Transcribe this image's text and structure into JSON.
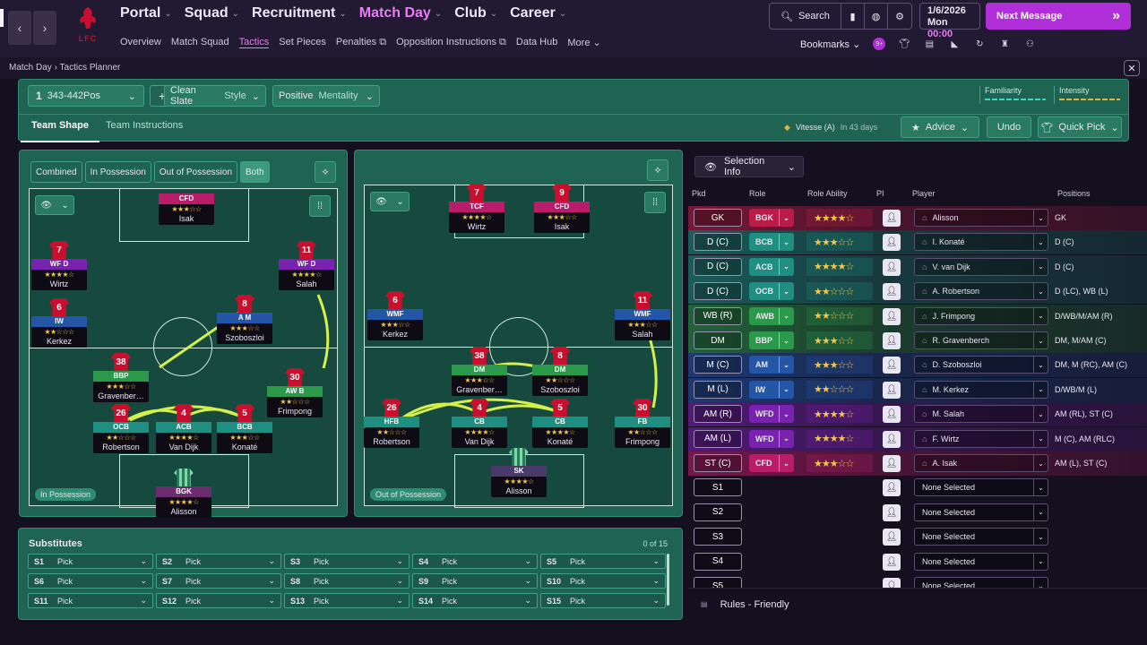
{
  "club_logo_text": "LFC",
  "nav": {
    "main": [
      {
        "label": "Portal",
        "active": false
      },
      {
        "label": "Squad",
        "active": false
      },
      {
        "label": "Recruitment",
        "active": false
      },
      {
        "label": "Match Day",
        "active": true
      },
      {
        "label": "Club",
        "active": false
      },
      {
        "label": "Career",
        "active": false
      }
    ],
    "sub": [
      "Overview",
      "Match Squad",
      "Tactics",
      "Set Pieces",
      "Penalties",
      "Opposition Instructions",
      "Data Hub",
      "More"
    ],
    "search_label": "Search",
    "date": "1/6/2026",
    "day": "Mon",
    "time": "00:00",
    "next_message": "Next Message",
    "bookmarks_label": "Bookmarks",
    "notification_badge": "9+"
  },
  "breadcrumb": {
    "root": "Match Day",
    "page": "Tactics Planner"
  },
  "tactic": {
    "number": "1",
    "formation": "343-442Pos",
    "style_value": "Clean Slate",
    "style_label": "Style",
    "mentality_value": "Positive",
    "mentality_label": "Mentality",
    "familiarity_label": "Familiarity",
    "intensity_label": "Intensity",
    "tabs": [
      "Team Shape",
      "Team Instructions"
    ],
    "next_match_opponent": "Vitesse (A)",
    "next_match_when": "In 43 days",
    "advice_label": "Advice",
    "undo_label": "Undo",
    "quick_pick_label": "Quick Pick"
  },
  "shape_toggle": [
    "Combined",
    "In Possession",
    "Out of Possession",
    "Both"
  ],
  "phase_labels": {
    "in": "In Possession",
    "out": "Out of Possession"
  },
  "in_possession": [
    {
      "num": "",
      "role": "CFD",
      "name": "Isak",
      "stars": "★★★☆☆"
    },
    {
      "num": "7",
      "role": "WF D",
      "name": "Wirtz",
      "stars": "★★★★☆"
    },
    {
      "num": "11",
      "role": "WF D",
      "name": "Salah",
      "stars": "★★★★☆"
    },
    {
      "num": "6",
      "role": "IW",
      "name": "Kerkez",
      "stars": "★★☆☆☆"
    },
    {
      "num": "8",
      "role": "A M",
      "name": "Szoboszloi",
      "stars": "★★★☆☆"
    },
    {
      "num": "38",
      "role": "BBP",
      "name": "Gravenber…",
      "stars": "★★★☆☆"
    },
    {
      "num": "30",
      "role": "AW B",
      "name": "Frimpong",
      "stars": "★★☆☆☆"
    },
    {
      "num": "26",
      "role": "OCB",
      "name": "Robertson",
      "stars": "★★☆☆☆"
    },
    {
      "num": "4",
      "role": "ACB",
      "name": "Van Dijk",
      "stars": "★★★★☆"
    },
    {
      "num": "5",
      "role": "BCB",
      "name": "Konaté",
      "stars": "★★★☆☆"
    },
    {
      "num": "",
      "role": "BGK",
      "name": "Alisson",
      "stars": "★★★★☆"
    }
  ],
  "out_possession": [
    {
      "num": "7",
      "role": "TCF",
      "name": "Wirtz",
      "stars": "★★★★☆"
    },
    {
      "num": "9",
      "role": "CFD",
      "name": "Isak",
      "stars": "★★★☆☆"
    },
    {
      "num": "6",
      "role": "WMF",
      "name": "Kerkez",
      "stars": "★★★☆☆"
    },
    {
      "num": "11",
      "role": "WMF",
      "name": "Salah",
      "stars": "★★★☆☆"
    },
    {
      "num": "38",
      "role": "DM",
      "name": "Gravenber…",
      "stars": "★★★☆☆"
    },
    {
      "num": "8",
      "role": "DM",
      "name": "Szoboszloi",
      "stars": "★★☆☆☆"
    },
    {
      "num": "26",
      "role": "HFB",
      "name": "Robertson",
      "stars": "★★☆☆☆"
    },
    {
      "num": "4",
      "role": "CB",
      "name": "Van Dijk",
      "stars": "★★★★☆"
    },
    {
      "num": "5",
      "role": "CB",
      "name": "Konaté",
      "stars": "★★★★☆"
    },
    {
      "num": "30",
      "role": "FB",
      "name": "Frimpong",
      "stars": "★★☆☆☆"
    },
    {
      "num": "",
      "role": "SK",
      "name": "Alisson",
      "stars": "★★★★☆"
    }
  ],
  "substitutes": {
    "title": "Substitutes",
    "count": "0 of 15",
    "slots": [
      {
        "id": "S1",
        "value": "Pick"
      },
      {
        "id": "S2",
        "value": "Pick"
      },
      {
        "id": "S3",
        "value": "Pick"
      },
      {
        "id": "S4",
        "value": "Pick"
      },
      {
        "id": "S5",
        "value": "Pick"
      },
      {
        "id": "S6",
        "value": "Pick"
      },
      {
        "id": "S7",
        "value": "Pick"
      },
      {
        "id": "S8",
        "value": "Pick"
      },
      {
        "id": "S9",
        "value": "Pick"
      },
      {
        "id": "S10",
        "value": "Pick"
      },
      {
        "id": "S11",
        "value": "Pick"
      },
      {
        "id": "S12",
        "value": "Pick"
      },
      {
        "id": "S13",
        "value": "Pick"
      },
      {
        "id": "S14",
        "value": "Pick"
      },
      {
        "id": "S15",
        "value": "Pick"
      }
    ]
  },
  "selection": {
    "dropdown_label": "Selection Info",
    "columns": [
      "Pkd",
      "Role",
      "Role Ability",
      "PI",
      "Player",
      "Positions"
    ],
    "rows": [
      {
        "pos": "GK",
        "role": "BGK",
        "stars": "★★★★☆",
        "player": "Alisson",
        "positions": "GK",
        "color": "#b91d47"
      },
      {
        "pos": "D (C)",
        "role": "BCB",
        "stars": "★★★☆☆",
        "player": "I. Konaté",
        "positions": "D (C)",
        "color": "#1e8f80"
      },
      {
        "pos": "D (C)",
        "role": "ACB",
        "stars": "★★★★☆",
        "player": "V. van Dijk",
        "positions": "D (C)",
        "color": "#1e8f80"
      },
      {
        "pos": "D (C)",
        "role": "OCB",
        "stars": "★★☆☆☆",
        "player": "A. Robertson",
        "positions": "D (LC), WB (L)",
        "color": "#1e8f80"
      },
      {
        "pos": "WB (R)",
        "role": "AWB",
        "stars": "★★☆☆☆",
        "player": "J. Frimpong",
        "positions": "D/WB/M/AM (R)",
        "color": "#2a9a4a"
      },
      {
        "pos": "DM",
        "role": "BBP",
        "stars": "★★★☆☆",
        "player": "R. Gravenberch",
        "positions": "DM, M/AM (C)",
        "color": "#2a9a4a"
      },
      {
        "pos": "M (C)",
        "role": "AM",
        "stars": "★★★☆☆",
        "player": "D. Szoboszloi",
        "positions": "DM, M (RC), AM (C)",
        "color": "#2456a8"
      },
      {
        "pos": "M (L)",
        "role": "IW",
        "stars": "★★☆☆☆",
        "player": "M. Kerkez",
        "positions": "D/WB/M (L)",
        "color": "#2456a8"
      },
      {
        "pos": "AM (R)",
        "role": "WFD",
        "stars": "★★★★☆",
        "player": "M. Salah",
        "positions": "AM (RL), ST (C)",
        "color": "#7a22b0"
      },
      {
        "pos": "AM (L)",
        "role": "WFD",
        "stars": "★★★★☆",
        "player": "F. Wirtz",
        "positions": "M (C), AM (RLC)",
        "color": "#7a22b0"
      },
      {
        "pos": "ST (C)",
        "role": "CFD",
        "stars": "★★★☆☆",
        "player": "A. Isak",
        "positions": "AM (L), ST (C)",
        "color": "#b91d6a"
      },
      {
        "pos": "S1",
        "role": "",
        "stars": "",
        "player": "None Selected",
        "positions": "",
        "color": ""
      },
      {
        "pos": "S2",
        "role": "",
        "stars": "",
        "player": "None Selected",
        "positions": "",
        "color": ""
      },
      {
        "pos": "S3",
        "role": "",
        "stars": "",
        "player": "None Selected",
        "positions": "",
        "color": ""
      },
      {
        "pos": "S4",
        "role": "",
        "stars": "",
        "player": "None Selected",
        "positions": "",
        "color": ""
      },
      {
        "pos": "S5",
        "role": "",
        "stars": "",
        "player": "None Selected",
        "positions": "",
        "color": ""
      }
    ]
  },
  "rules_label": "Rules - Friendly"
}
